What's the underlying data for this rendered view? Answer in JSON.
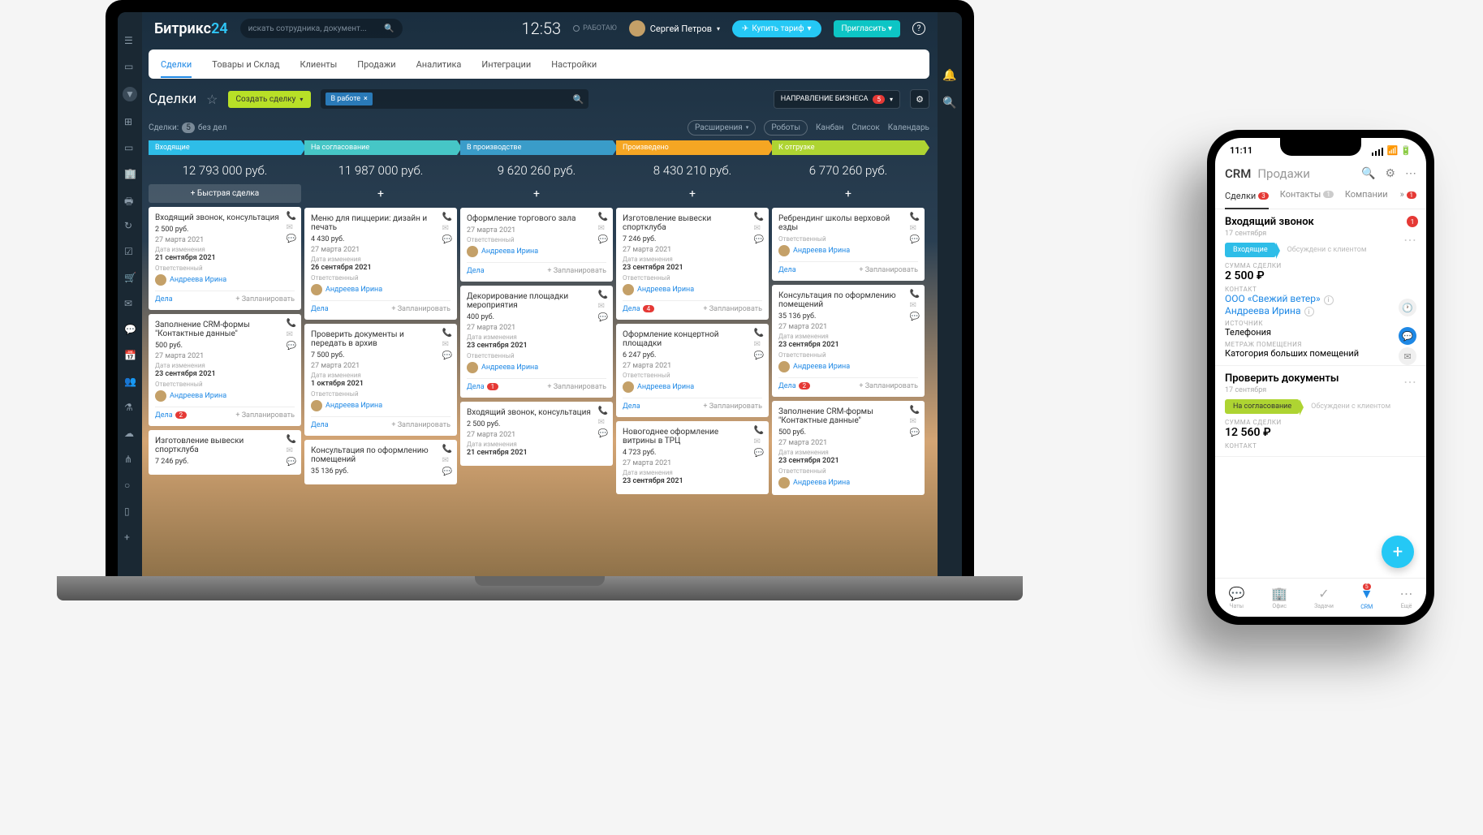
{
  "header": {
    "logo1": "Битрикс",
    "logo2": "24",
    "search_placeholder": "искать сотрудника, документ...",
    "clock": "12:53",
    "work_status": "РАБОТАЮ",
    "user_name": "Сергей Петров",
    "buy_btn": "Купить тариф",
    "invite_btn": "Пригласить"
  },
  "nav": {
    "tabs": [
      "Сделки",
      "Товары и Склад",
      "Клиенты",
      "Продажи",
      "Аналитика",
      "Интеграции",
      "Настройки"
    ]
  },
  "page": {
    "title": "Сделки",
    "create_btn": "Создать сделку",
    "filter_tag": "В работе",
    "direction_label": "НАПРАВЛЕНИЕ БИЗНЕСА",
    "direction_badge": "5",
    "deals_prefix": "Сделки:",
    "deals_count": "5",
    "deals_suffix": "без дел",
    "ext_btn": "Расширения",
    "robots_btn": "Роботы",
    "views": [
      "Канбан",
      "Список",
      "Календарь"
    ]
  },
  "labels": {
    "quick_deal": "+ Быстрая сделка",
    "date_change": "Дата изменения",
    "responsible": "Ответственный",
    "dela": "Дела",
    "plan": "+ Запланировать",
    "resp_name": "Андреева Ирина"
  },
  "columns": [
    {
      "title": "Входящие",
      "sum": "12 793 000 руб.",
      "cls": "c1",
      "quick": true,
      "cards": [
        {
          "title": "Входящий звонок, консультация",
          "price": "2 500 руб.",
          "d1": "27 марта 2021",
          "d2": "21 сентября 2021",
          "resp": true,
          "foot": true
        },
        {
          "title": "Заполнение CRM-формы \"Контактные данные\"",
          "price": "500 руб.",
          "d1": "27 марта 2021",
          "d2": "23 сентября 2021",
          "resp": true,
          "foot": true,
          "bubble": "2"
        },
        {
          "title": "Изготовление вывески спортклуба",
          "price": "7 246 руб."
        }
      ]
    },
    {
      "title": "На согласование",
      "sum": "11 987 000 руб.",
      "cls": "c2",
      "cards": [
        {
          "title": "Меню для пиццерии: дизайн и печать",
          "price": "4 430 руб.",
          "d1": "27 марта 2021",
          "d2": "26 сентября 2021",
          "resp": true,
          "foot": true
        },
        {
          "title": "Проверить документы и передать в архив",
          "price": "7 500 руб.",
          "d1": "27 марта 2021",
          "d2": "1 октября 2021",
          "resp": true,
          "foot": true
        },
        {
          "title": "Консультация по оформлению помещений",
          "price": "35 136 руб."
        }
      ]
    },
    {
      "title": "В производстве",
      "sum": "9 620 260 руб.",
      "cls": "c3",
      "cards": [
        {
          "title": "Оформление торгового зала",
          "d1": "27 марта 2021",
          "resp": true,
          "foot": true,
          "no_price": true
        },
        {
          "title": "Декорирование площадки мероприятия",
          "price": "400 руб.",
          "d1": "27 марта 2021",
          "d2": "23 сентября 2021",
          "resp": true,
          "foot": true,
          "bubble": "1"
        },
        {
          "title": "Входящий звонок, консультация",
          "price": "2 500 руб.",
          "d1": "27 марта 2021",
          "d2": "21 сентября 2021"
        }
      ]
    },
    {
      "title": "Произведено",
      "sum": "8 430 210 руб.",
      "cls": "c4",
      "cards": [
        {
          "title": "Изготовление вывески спортклуба",
          "price": "7 246 руб.",
          "d1": "27 марта 2021",
          "d2": "23 сентября 2021",
          "resp": true,
          "foot": true,
          "bubble": "4"
        },
        {
          "title": "Оформление концертной площадки",
          "price": "6 247 руб.",
          "d1": "27 марта 2021",
          "resp": true,
          "foot": true
        },
        {
          "title": "Новогоднее оформление витрины в ТРЦ",
          "price": "4 723 руб.",
          "d1": "27 марта 2021",
          "d2": "23 сентября 2021"
        }
      ]
    },
    {
      "title": "К отгрузке",
      "sum": "6 770 260 руб.",
      "cls": "c5",
      "cards": [
        {
          "title": "Ребрендинг школы верховой езды",
          "resp": true,
          "foot": true,
          "no_price": true
        },
        {
          "title": "Консультация по оформлению помещений",
          "price": "35 136 руб.",
          "d1": "27 марта 2021",
          "d2": "23 сентября 2021",
          "resp": true,
          "foot": true,
          "bubble": "2"
        },
        {
          "title": "Заполнение CRM-формы \"Контактные данные\"",
          "price": "500 руб.",
          "d1": "27 марта 2021",
          "d2": "23 сентября 2021",
          "resp": true
        }
      ]
    }
  ],
  "phone": {
    "time": "11:11",
    "hdr1": "CRM",
    "hdr2": "Продажи",
    "tabs": [
      {
        "l": "Сделки",
        "b": "3",
        "active": true
      },
      {
        "l": "Контакты",
        "b": "1",
        "gray": true
      },
      {
        "l": "Компании"
      }
    ],
    "more_badge": "1",
    "card1": {
      "title": "Входящий звонок",
      "date": "17 сентября",
      "tag": "Входящие",
      "next": "Обсуждени с клиентом",
      "sum_lbl": "СУММА СДЕЛКИ",
      "sum": "2 500 ₽",
      "contact_lbl": "КОНТАКТ",
      "company": "ООО «Свежий ветер»",
      "person": "Андреева Ирина",
      "src_lbl": "ИСТОЧНИК",
      "src": "Телефония",
      "m_lbl": "МЕТРАЖ ПОМЕЩЕНИЯ",
      "m": "Катогория больших помещений"
    },
    "card2": {
      "title": "Проверить документы",
      "date": "17 сентября",
      "tag": "На согласование",
      "next": "Обсуждени с клиентом",
      "sum_lbl": "СУММА СДЕЛКИ",
      "sum": "12 560 ₽",
      "contact_lbl": "КОНТАКТ"
    },
    "nav": [
      {
        "l": "Чаты",
        "i": "💬"
      },
      {
        "l": "Офис",
        "i": "🏢"
      },
      {
        "l": "Задачи",
        "i": "✓"
      },
      {
        "l": "CRM",
        "i": "▼",
        "active": true,
        "b": "5"
      },
      {
        "l": "Ещё",
        "i": "⋯"
      }
    ]
  }
}
